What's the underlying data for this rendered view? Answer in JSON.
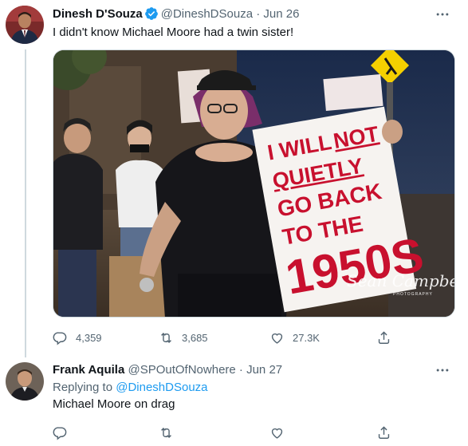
{
  "tweet1": {
    "author_name": "Dinesh D'Souza",
    "author_handle": "@DineshDSouza",
    "separator": "·",
    "date": "Jun 26",
    "text": "I didn't know Michael Moore had a twin sister!",
    "image": {
      "sign_lines": [
        "I WILL",
        "NOT",
        "QUIETLY",
        "GO BACK",
        "TO THE",
        "1950S"
      ],
      "watermark_name": "Sean Campbell",
      "watermark_sub": "PHOTOGRAPHY"
    },
    "actions": {
      "replies": "4,359",
      "retweets": "3,685",
      "likes": "27.3K"
    }
  },
  "tweet2": {
    "author_name": "Frank Aquila",
    "author_handle": "@SPOutOfNowhere",
    "separator": "·",
    "date": "Jun 27",
    "replying_prefix": "Replying to",
    "replying_to": "@DineshDSouza",
    "text": "Michael Moore on drag"
  },
  "colors": {
    "accent": "#1d9bf0",
    "text_primary": "#0f1419",
    "text_secondary": "#536471",
    "sign_red": "#c8102e"
  },
  "icons": [
    "verified-badge-icon",
    "more-icon",
    "reply-icon",
    "retweet-icon",
    "like-icon",
    "share-icon"
  ]
}
